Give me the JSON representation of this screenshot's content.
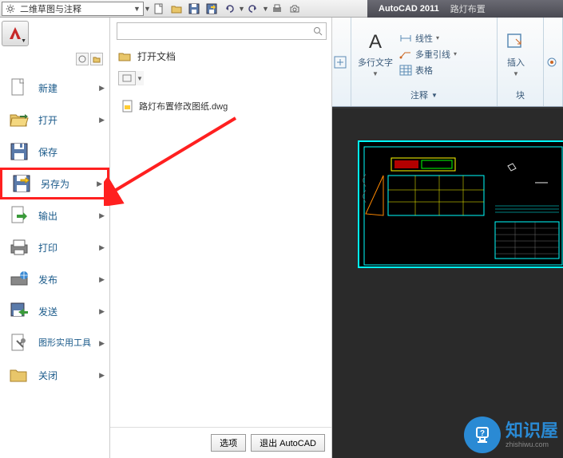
{
  "workspace": {
    "label": "二维草图与注释"
  },
  "titlebar": {
    "product": "AutoCAD 2011",
    "document": "路灯布置"
  },
  "app_menu": {
    "items": [
      {
        "label": "新建"
      },
      {
        "label": "打开"
      },
      {
        "label": "保存"
      },
      {
        "label": "另存为"
      },
      {
        "label": "输出"
      },
      {
        "label": "打印"
      },
      {
        "label": "发布"
      },
      {
        "label": "发送"
      },
      {
        "label": "图形实用工具"
      },
      {
        "label": "关闭"
      }
    ]
  },
  "recent": {
    "header": "打开文档",
    "file": "路灯布置修改图纸.dwg",
    "options_btn": "选项",
    "exit_btn": "退出 AutoCAD"
  },
  "ribbon": {
    "multiline_text": "多行文字",
    "linetype": "线性",
    "multileader": "多重引线",
    "table": "表格",
    "annotate": "注释",
    "insert": "插入",
    "block_label": "块"
  },
  "watermark": {
    "brand": "知识屋",
    "domain": "zhishiwu.com"
  },
  "colors": {
    "cyan": "#00ffff",
    "red": "#ff2020",
    "accent": "#2a8ad4"
  }
}
